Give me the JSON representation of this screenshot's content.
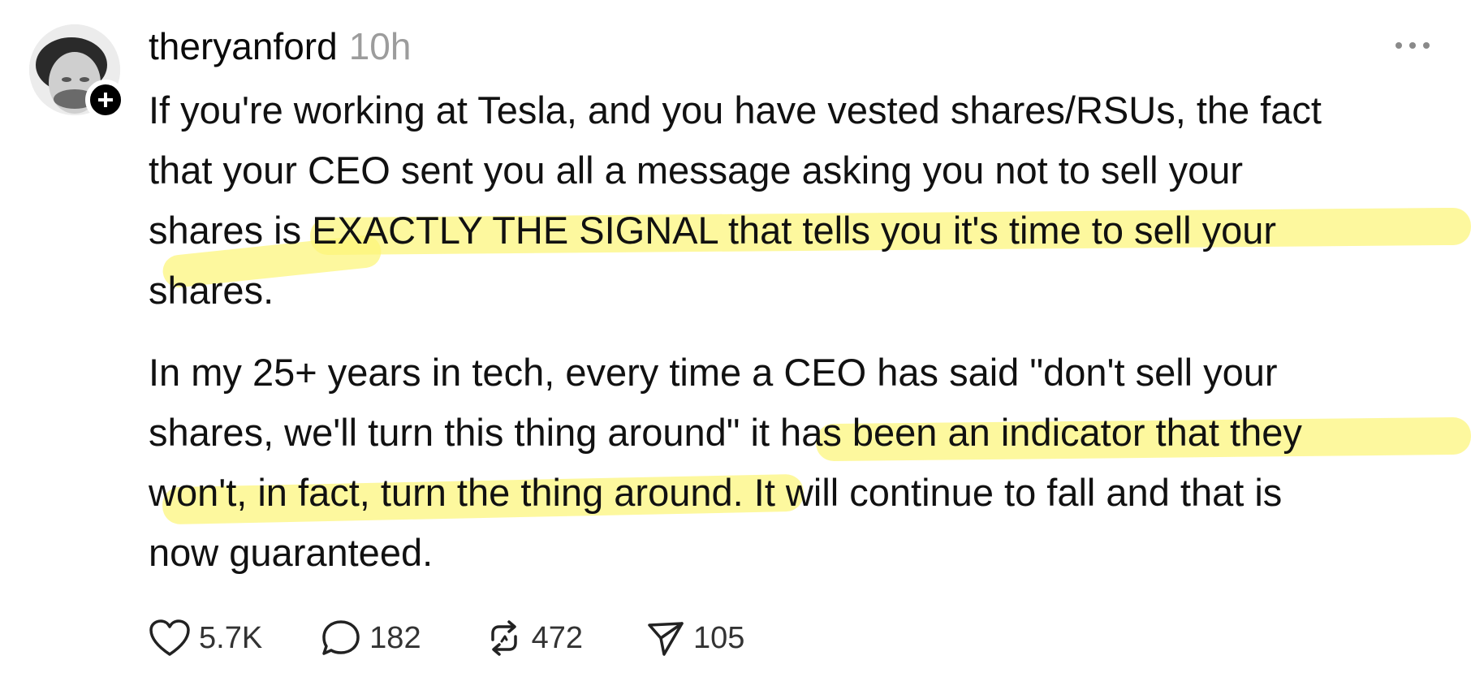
{
  "post": {
    "username": "theryanford",
    "timestamp": "10h",
    "paragraph1": {
      "line1": "If you're working at Tesla, and you have vested shares/RSUs, the fact",
      "line2": "that your CEO sent you all a message asking you not to sell your",
      "line3_plain": "shares i",
      "line3_highlight": "s EXACTLY THE SIGNAL that tells you it's time to sell your",
      "line4_highlight": "shares",
      "line4_plain": "."
    },
    "paragraph2": {
      "line1": "In my 25+ years in tech, every time a CEO has said \"don't sell your",
      "line2_plain": "shares, we'll turn this thing around\" ",
      "line2_highlight": "it has been an indicator that they",
      "line3_highlight": "won't, in fact, turn the thing around.",
      "line3_plain": " It will continue to fall and that is",
      "line4": "now guaranteed."
    }
  },
  "actions": {
    "like_count": "5.7K",
    "reply_count": "182",
    "repost_count": "472",
    "share_count": "105"
  },
  "icons": {
    "follow": "plus-icon",
    "more": "more-options-icon",
    "like": "heart-icon",
    "reply": "comment-bubble-icon",
    "repost": "repost-icon",
    "share": "send-icon"
  },
  "colors": {
    "highlight": "#FCF578",
    "muted_text": "#9c9c9c",
    "badge": "#000000"
  }
}
